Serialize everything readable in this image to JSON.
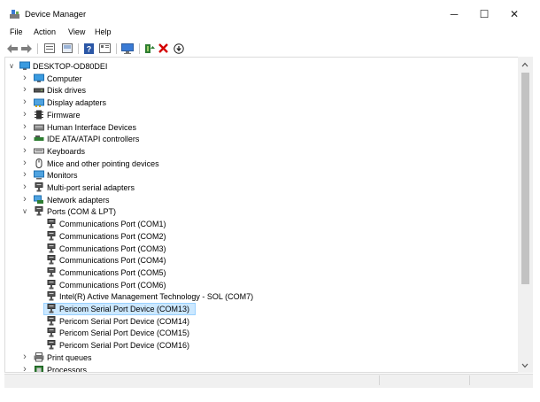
{
  "window": {
    "title": "Device Manager",
    "minimize_glyph": "─",
    "maximize_glyph": "☐",
    "close_glyph": "✕"
  },
  "menu": {
    "file": "File",
    "action": "Action",
    "view": "View",
    "help": "Help"
  },
  "toolbar": {
    "icons": [
      "back-arrow-icon",
      "forward-arrow-icon",
      "properties-icon",
      "show-hidden-icon",
      "help-icon",
      "view-icon",
      "scan-hardware-icon",
      "update-driver-icon",
      "uninstall-icon",
      "download-icon"
    ]
  },
  "tree": {
    "root": "DESKTOP-OD80DEI",
    "categories": [
      {
        "label": "Computer",
        "icon": "computer-icon"
      },
      {
        "label": "Disk drives",
        "icon": "disk-drive-icon"
      },
      {
        "label": "Display adapters",
        "icon": "display-adapter-icon"
      },
      {
        "label": "Firmware",
        "icon": "firmware-icon"
      },
      {
        "label": "Human Interface Devices",
        "icon": "hid-icon"
      },
      {
        "label": "IDE ATA/ATAPI controllers",
        "icon": "ide-controller-icon"
      },
      {
        "label": "Keyboards",
        "icon": "keyboard-icon"
      },
      {
        "label": "Mice and other pointing devices",
        "icon": "mouse-icon"
      },
      {
        "label": "Monitors",
        "icon": "monitor-icon"
      },
      {
        "label": "Multi-port serial adapters",
        "icon": "serial-adapter-icon"
      },
      {
        "label": "Network adapters",
        "icon": "network-adapter-icon"
      },
      {
        "label": "Ports (COM & LPT)",
        "icon": "port-icon"
      }
    ],
    "ports": [
      "Communications Port (COM1)",
      "Communications Port (COM2)",
      "Communications Port (COM3)",
      "Communications Port (COM4)",
      "Communications Port (COM5)",
      "Communications Port (COM6)",
      "Intel(R) Active Management Technology - SOL (COM7)",
      "Pericom Serial Port Device (COM13)",
      "Pericom Serial Port Device (COM14)",
      "Pericom Serial Port Device (COM15)",
      "Pericom Serial Port Device (COM16)"
    ],
    "selected_port": "Pericom Serial Port Device (COM13)",
    "after": [
      {
        "label": "Print queues",
        "icon": "printer-icon"
      },
      {
        "label": "Processors",
        "icon": "processor-icon"
      }
    ]
  },
  "colors": {
    "selection_bg": "#cce8ff",
    "selection_border": "#99d1ff",
    "uninstall_red": "#d40000"
  }
}
